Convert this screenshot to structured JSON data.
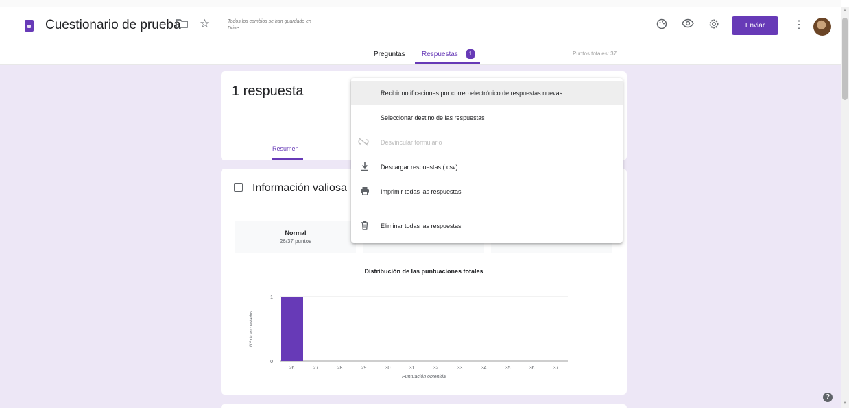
{
  "header": {
    "title": "Cuestionario de prueba",
    "save_status": "Todos los cambios se han guardado en Drive",
    "send_label": "Enviar",
    "icons": [
      "forms-app-icon",
      "folder-icon",
      "star-icon",
      "palette-icon",
      "eye-icon",
      "gear-icon",
      "more-vert-icon",
      "avatar"
    ]
  },
  "tabs": {
    "questions": "Preguntas",
    "responses": "Respuestas",
    "responses_badge": "1",
    "total_points": "Puntos totales: 37"
  },
  "summary": {
    "count_label": "1 respuesta",
    "tab_label": "Resumen"
  },
  "insights": {
    "title": "Información valiosa",
    "stats": [
      {
        "label": "Normal",
        "sub": "26/37 puntos"
      }
    ]
  },
  "menu": {
    "items": [
      {
        "label": "Recibir notificaciones por correo electrónico de respuestas nuevas",
        "icon": "",
        "disabled": false
      },
      {
        "label": "Seleccionar destino de las respuestas",
        "icon": "",
        "disabled": false
      },
      {
        "label": "Desvincular formulario",
        "icon": "link-off-icon",
        "disabled": true
      },
      {
        "label": "Descargar respuestas (.csv)",
        "icon": "download-icon",
        "disabled": false
      },
      {
        "label": "Imprimir todas las respuestas",
        "icon": "print-icon",
        "disabled": false
      },
      {
        "label": "Eliminar todas las respuestas",
        "icon": "trash-icon",
        "disabled": false
      }
    ]
  },
  "chart_data": {
    "type": "bar",
    "title": "Distribución de las puntuaciones totales",
    "xlabel": "Puntuación obtenida",
    "ylabel": "N.º de encuestados",
    "categories": [
      "26",
      "27",
      "28",
      "29",
      "30",
      "31",
      "32",
      "33",
      "34",
      "35",
      "36",
      "37"
    ],
    "values": [
      1,
      0,
      0,
      0,
      0,
      0,
      0,
      0,
      0,
      0,
      0,
      0
    ],
    "ylim": [
      0,
      1
    ],
    "yticks": [
      "0",
      "1"
    ],
    "bar_color": "#673ab7",
    "grid": true
  },
  "colors": {
    "accent": "#673ab7",
    "background": "#ede7f6"
  }
}
